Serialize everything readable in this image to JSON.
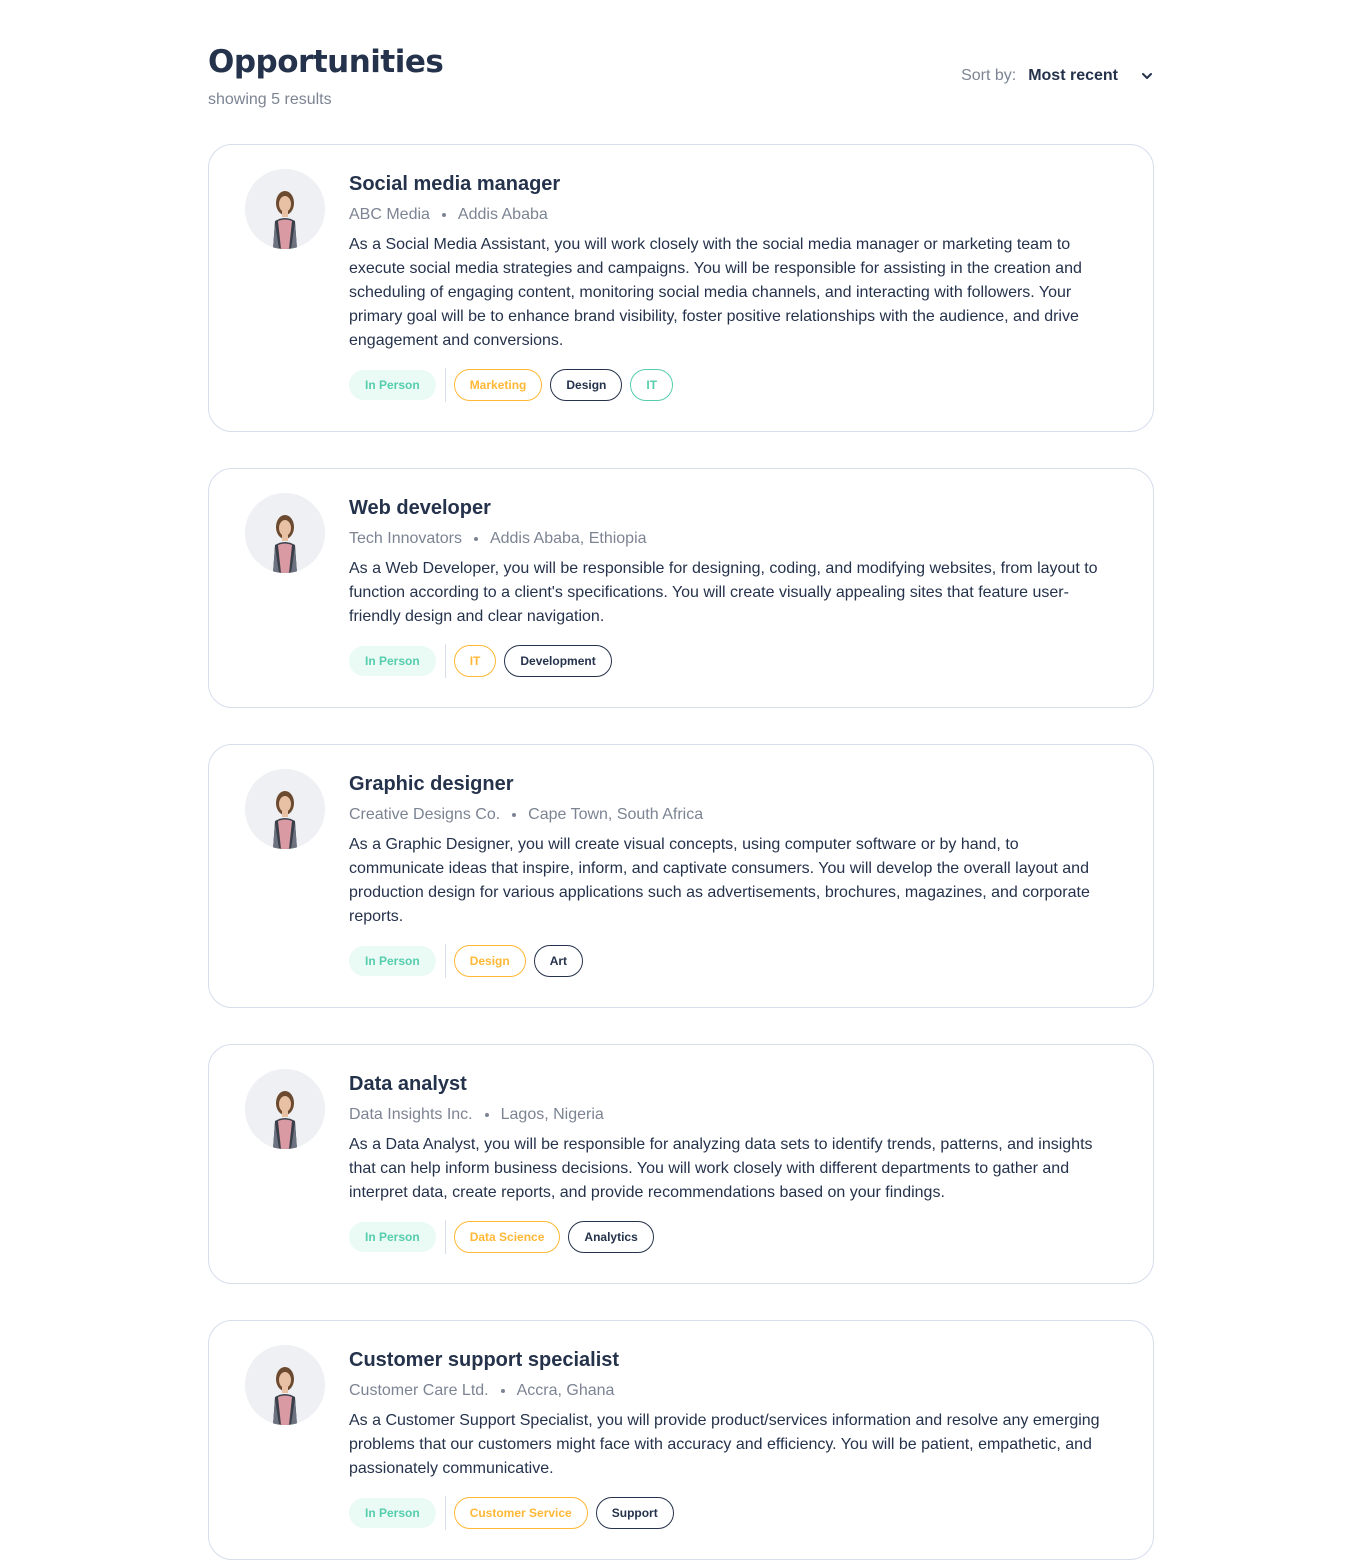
{
  "header": {
    "title": "Opportunities",
    "results": "showing 5 results",
    "sort_label": "Sort by:",
    "sort_value": "Most recent"
  },
  "jobs": [
    {
      "title": "Social media manager",
      "company": "ABC Media",
      "location": "Addis Ababa",
      "description": "As a Social Media Assistant, you will work closely with the social media manager or marketing team to execute social media strategies and campaigns. You will be responsible for assisting in the creation and scheduling of engaging content, monitoring social media channels, and interacting with followers. Your primary goal will be to enhance brand visibility, foster positive relationships with the audience, and drive engagement and conversions.",
      "type": "In Person",
      "tags": [
        "Marketing",
        "Design",
        "IT"
      ]
    },
    {
      "title": "Web developer",
      "company": "Tech Innovators",
      "location": "Addis Ababa, Ethiopia",
      "description": "As a Web Developer, you will be responsible for designing, coding, and modifying websites, from layout to function according to a client's specifications. You will create visually appealing sites that feature user-friendly design and clear navigation.",
      "type": "In Person",
      "tags": [
        "IT",
        "Development"
      ]
    },
    {
      "title": "Graphic designer",
      "company": "Creative Designs Co.",
      "location": "Cape Town, South Africa",
      "description": "As a Graphic Designer, you will create visual concepts, using computer software or by hand, to communicate ideas that inspire, inform, and captivate consumers. You will develop the overall layout and production design for various applications such as advertisements, brochures, magazines, and corporate reports.",
      "type": "In Person",
      "tags": [
        "Design",
        "Art"
      ]
    },
    {
      "title": "Data analyst",
      "company": "Data Insights Inc.",
      "location": "Lagos, Nigeria",
      "description": "As a Data Analyst, you will be responsible for analyzing data sets to identify trends, patterns, and insights that can help inform business decisions. You will work closely with different departments to gather and interpret data, create reports, and provide recommendations based on your findings.",
      "type": "In Person",
      "tags": [
        "Data Science",
        "Analytics"
      ]
    },
    {
      "title": "Customer support specialist",
      "company": "Customer Care Ltd.",
      "location": "Accra, Ghana",
      "description": "As a Customer Support Specialist, you will provide product/services information and resolve any emerging problems that our customers might face with accuracy and efficiency. You will be patient, empathetic, and passionately communicative.",
      "type": "In Person",
      "tags": [
        "Customer Service",
        "Support"
      ]
    }
  ],
  "colors": {
    "type_tag_bg": "#eafaf4",
    "type_tag_text": "#56cdad",
    "tag_orange": "#ffb836",
    "tag_dark": "#25324b",
    "tag_teal": "#56cdad"
  },
  "icons": {
    "sort_dropdown": "chevron-down-icon",
    "avatar": "company-avatar"
  }
}
